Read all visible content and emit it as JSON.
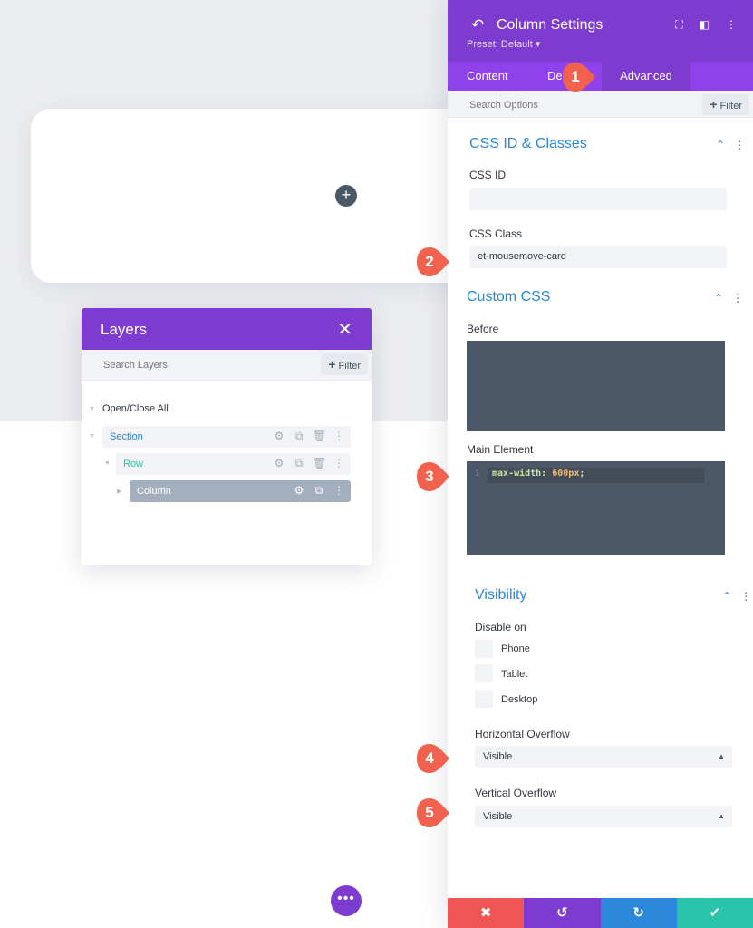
{
  "builder": {
    "add_symbol": "+",
    "more_symbol": "•••"
  },
  "layers": {
    "title": "Layers",
    "close_icon": "✕",
    "search_placeholder": "Search Layers",
    "filter_label": "Filter",
    "open_close_all": "Open/Close All",
    "items": [
      {
        "label": "Section",
        "color": "#2b87da"
      },
      {
        "label": "Row",
        "color": "#29c4a9"
      },
      {
        "label": "Column",
        "color": "#ffffff"
      }
    ]
  },
  "settings": {
    "title": "Column Settings",
    "preset": "Preset: Default ▾",
    "tabs": [
      "Content",
      "De",
      "Advanced"
    ],
    "search_placeholder": "Search Options",
    "filter_label": "Filter",
    "css_section": {
      "title": "CSS ID & Classes",
      "css_id_label": "CSS ID",
      "css_id_value": "",
      "css_class_label": "CSS Class",
      "css_class_value": "et-mousemove-card"
    },
    "custom_css": {
      "title": "Custom CSS",
      "before_label": "Before",
      "main_label": "Main Element",
      "line_number": "1",
      "code_prop": "max-width:",
      "code_value": "600px",
      "code_end": ";"
    },
    "visibility": {
      "title": "Visibility",
      "disable_on": "Disable on",
      "devices": [
        "Phone",
        "Tablet",
        "Desktop"
      ],
      "h_overflow_label": "Horizontal Overflow",
      "h_overflow_value": "Visible",
      "v_overflow_label": "Vertical Overflow",
      "v_overflow_value": "Visible"
    },
    "footer_colors": [
      "#ef5555",
      "#7d3bcf",
      "#2b87da",
      "#29c4a9"
    ]
  },
  "markers": [
    "1",
    "2",
    "3",
    "4",
    "5"
  ],
  "colors": {
    "purple": "#7d3bcf",
    "accent_blue": "#2b87da",
    "marker_red": "#f0624d"
  }
}
